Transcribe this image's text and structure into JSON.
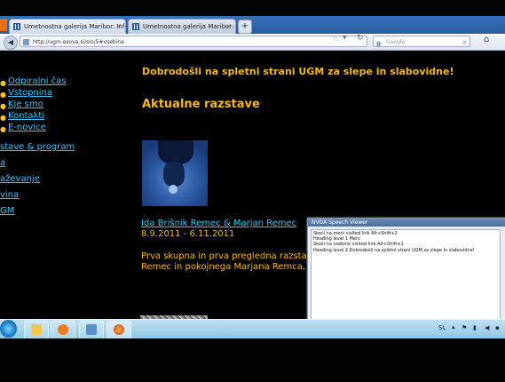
{
  "browser": {
    "tabs": [
      {
        "label": "Umetnostna galerija Maribor: Info"
      },
      {
        "label": "Umetnostna galerija Maribor: Info"
      }
    ],
    "new_tab": "+",
    "url": "http://ugm.esova.si/slo/5#vsebina",
    "search_placeholder": "Google"
  },
  "page": {
    "menu": [
      "Odpiralni čas",
      "Vstopnina",
      "Kje smo",
      "Kontakti",
      "E-novice"
    ],
    "left_nav": [
      "stave & program",
      "a",
      "aževanje",
      "vina",
      "GM"
    ],
    "welcome": "Dobrodošli na spletni strani UGM za slepe in slabovidne!",
    "section_title": "Aktualne razstave",
    "exhibition": {
      "title": "Ida Brišnik Remec & Marjan Remec",
      "dates": "8.9.2011 - 6.11.2011",
      "desc_line1": "Prva skupna in prva pregledna razstava",
      "desc_line2": "Remec in pokojnega Marjana Remca, je"
    }
  },
  "nvda": {
    "title": "NVDA Speech Viewer",
    "lines": [
      "Skoči na meni visited link Alt+Shift+2",
      "Heading level 1 Mers",
      "Skoči na vsebino visited link Alt+Shift+1",
      "Heading level 2 Dobrodošli na spletni strani UGM za slepe in slabovidne!"
    ]
  },
  "taskbar": {
    "language": "SL"
  },
  "colors": {
    "accent_yellow": "#f5b81a",
    "link_blue": "#33c6ff"
  }
}
